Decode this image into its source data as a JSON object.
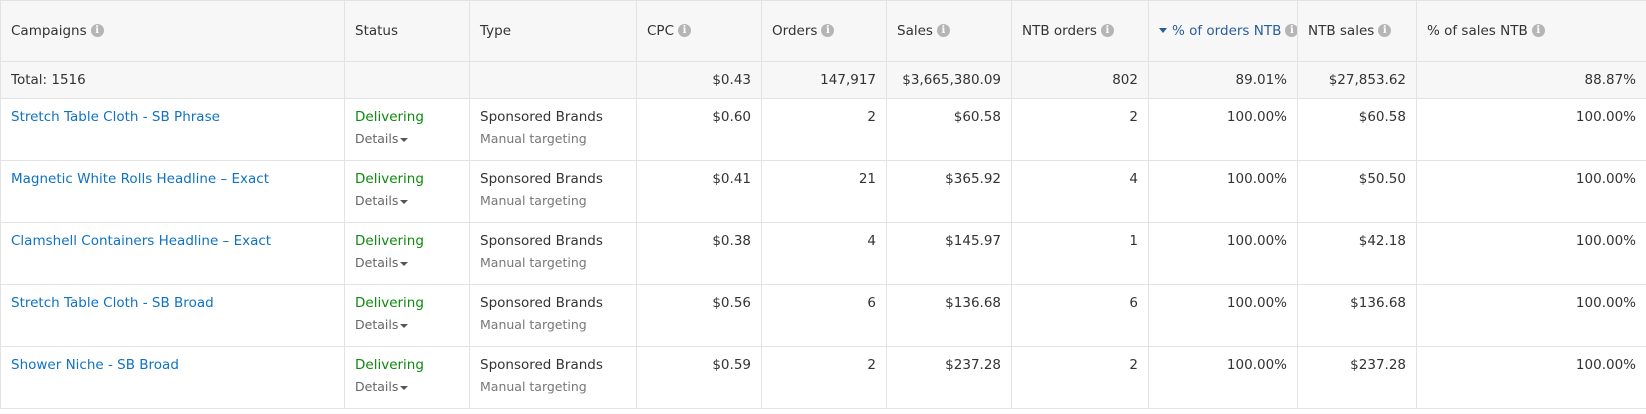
{
  "columns": {
    "campaigns": "Campaigns",
    "status": "Status",
    "type": "Type",
    "cpc": "CPC",
    "orders": "Orders",
    "sales": "Sales",
    "ntb_orders": "NTB orders",
    "pct_orders_ntb": "% of orders NTB",
    "ntb_sales": "NTB sales",
    "pct_sales_ntb": "% of sales NTB"
  },
  "total": {
    "label": "Total: 1516",
    "cpc": "$0.43",
    "orders": "147,917",
    "sales": "$3,665,380.09",
    "ntb_orders": "802",
    "pct_orders_ntb": "89.01%",
    "ntb_sales": "$27,853.62",
    "pct_sales_ntb": "88.87%"
  },
  "rows": [
    {
      "name": "Stretch Table Cloth - SB Phrase",
      "status": "Delivering",
      "details": "Details",
      "type": "Sponsored Brands",
      "targeting": "Manual targeting",
      "cpc": "$0.60",
      "orders": "2",
      "sales": "$60.58",
      "ntb_orders": "2",
      "pct_orders_ntb": "100.00%",
      "ntb_sales": "$60.58",
      "pct_sales_ntb": "100.00%"
    },
    {
      "name": "Magnetic White Rolls Headline – Exact",
      "status": "Delivering",
      "details": "Details",
      "type": "Sponsored Brands",
      "targeting": "Manual targeting",
      "cpc": "$0.41",
      "orders": "21",
      "sales": "$365.92",
      "ntb_orders": "4",
      "pct_orders_ntb": "100.00%",
      "ntb_sales": "$50.50",
      "pct_sales_ntb": "100.00%"
    },
    {
      "name": "Clamshell Containers Headline – Exact",
      "status": "Delivering",
      "details": "Details",
      "type": "Sponsored Brands",
      "targeting": "Manual targeting",
      "cpc": "$0.38",
      "orders": "4",
      "sales": "$145.97",
      "ntb_orders": "1",
      "pct_orders_ntb": "100.00%",
      "ntb_sales": "$42.18",
      "pct_sales_ntb": "100.00%"
    },
    {
      "name": "Stretch Table Cloth - SB Broad",
      "status": "Delivering",
      "details": "Details",
      "type": "Sponsored Brands",
      "targeting": "Manual targeting",
      "cpc": "$0.56",
      "orders": "6",
      "sales": "$136.68",
      "ntb_orders": "6",
      "pct_orders_ntb": "100.00%",
      "ntb_sales": "$136.68",
      "pct_sales_ntb": "100.00%"
    },
    {
      "name": "Shower Niche - SB Broad",
      "status": "Delivering",
      "details": "Details",
      "type": "Sponsored Brands",
      "targeting": "Manual targeting",
      "cpc": "$0.59",
      "orders": "2",
      "sales": "$237.28",
      "ntb_orders": "2",
      "pct_orders_ntb": "100.00%",
      "ntb_sales": "$237.28",
      "pct_sales_ntb": "100.00%"
    }
  ],
  "colors": {
    "link": "#0f72c4",
    "delivering": "#0d8a0d",
    "sorted_header": "#2a5d9b",
    "header_bg": "#f7f7f7",
    "border": "#e3e3e3"
  },
  "icons": {
    "info": "info-icon",
    "sort": "sort-descending-icon",
    "details_caret": "caret-down-icon"
  }
}
